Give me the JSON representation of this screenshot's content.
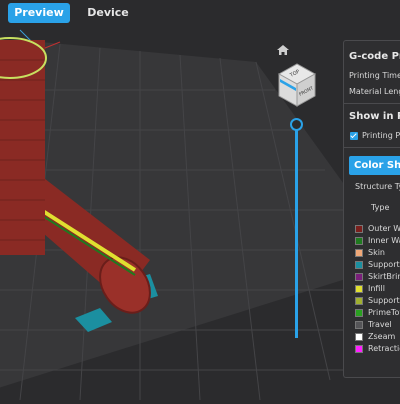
{
  "tabs": {
    "preview": "Preview",
    "device": "Device"
  },
  "panel": {
    "gcode_title": "G-code Pre",
    "printing_time": "Printing Time:",
    "material_length": "Material Lengt",
    "show_in": "Show in Pr",
    "printing_plate": "Printing Pla",
    "color_scheme": "Color Sho",
    "structure_type": "Structure Ty",
    "type_header": "Type"
  },
  "legend": [
    {
      "label": "Outer Wa",
      "color": "#7a1f1c"
    },
    {
      "label": "Inner Wa",
      "color": "#1f7a1f"
    },
    {
      "label": "Skin",
      "color": "#f0a878"
    },
    {
      "label": "Support",
      "color": "#1b8fa0"
    },
    {
      "label": "SkirtBrim",
      "color": "#7a1f7a"
    },
    {
      "label": "Infill",
      "color": "#e0e030"
    },
    {
      "label": "SupportI",
      "color": "#a0b030"
    },
    {
      "label": "PrimeTow",
      "color": "#2aa020"
    },
    {
      "label": "Travel",
      "color": "#555558"
    },
    {
      "label": "Zseam",
      "color": "#ffffff"
    },
    {
      "label": "Retractio",
      "color": "#ff20ff"
    }
  ],
  "colors": {
    "accent": "#2aa2e8",
    "background": "#2b2b2d",
    "panel": "#2e2e30"
  },
  "icons": {
    "home": "home-icon",
    "view_cube": "view-cube-icon"
  },
  "cube": {
    "top_face": "TOP",
    "front_face": "FRONT"
  }
}
